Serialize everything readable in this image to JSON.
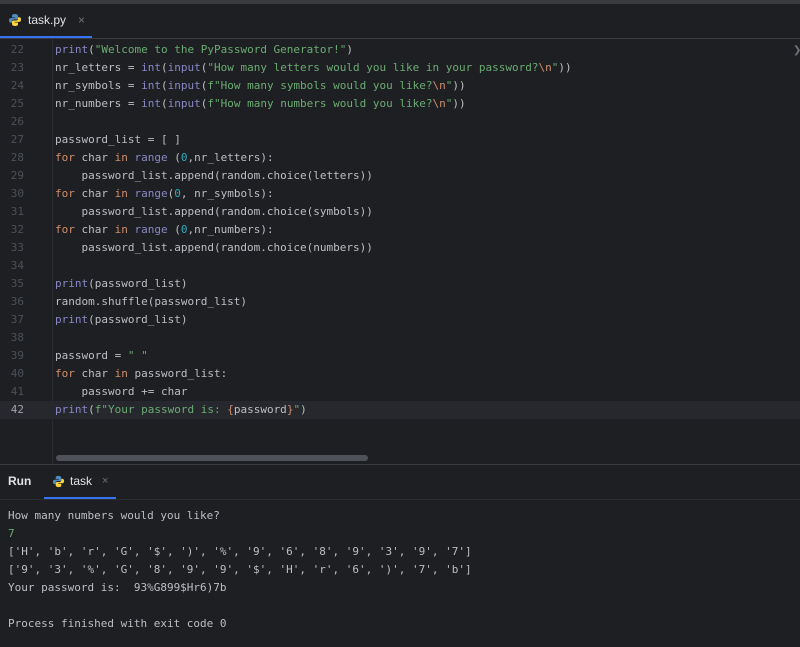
{
  "tab": {
    "filename": "task.py",
    "close": "×",
    "icon": "python-icon"
  },
  "editor": {
    "lines": [
      {
        "n": "22",
        "tokens": [
          [
            "bi",
            "print"
          ],
          [
            "p",
            "("
          ],
          [
            "st",
            "\"Welcome to the PyPassword Generator!\""
          ],
          [
            "p",
            ")"
          ]
        ]
      },
      {
        "n": "23",
        "tokens": [
          [
            "p",
            "nr_letters = "
          ],
          [
            "bi",
            "int"
          ],
          [
            "p",
            "("
          ],
          [
            "bi",
            "input"
          ],
          [
            "p",
            "("
          ],
          [
            "st",
            "\"How many letters would you like in your password?"
          ],
          [
            "esc",
            "\\n"
          ],
          [
            "st",
            "\""
          ],
          [
            "p",
            "))"
          ]
        ]
      },
      {
        "n": "24",
        "tokens": [
          [
            "p",
            "nr_symbols = "
          ],
          [
            "bi",
            "int"
          ],
          [
            "p",
            "("
          ],
          [
            "bi",
            "input"
          ],
          [
            "p",
            "("
          ],
          [
            "st",
            "f\"How many symbols would you like?"
          ],
          [
            "esc",
            "\\n"
          ],
          [
            "st",
            "\""
          ],
          [
            "p",
            "))"
          ]
        ]
      },
      {
        "n": "25",
        "tokens": [
          [
            "p",
            "nr_numbers = "
          ],
          [
            "bi",
            "int"
          ],
          [
            "p",
            "("
          ],
          [
            "bi",
            "input"
          ],
          [
            "p",
            "("
          ],
          [
            "st",
            "f\"How many numbers would you like?"
          ],
          [
            "esc",
            "\\n"
          ],
          [
            "st",
            "\""
          ],
          [
            "p",
            "))"
          ]
        ]
      },
      {
        "n": "26",
        "tokens": []
      },
      {
        "n": "27",
        "tokens": [
          [
            "p",
            "password_list = [ ]"
          ]
        ]
      },
      {
        "n": "28",
        "tokens": [
          [
            "kw",
            "for"
          ],
          [
            "p",
            " char "
          ],
          [
            "kw",
            "in"
          ],
          [
            "p",
            " "
          ],
          [
            "bi",
            "range"
          ],
          [
            "p",
            " ("
          ],
          [
            "num",
            "0"
          ],
          [
            "p",
            ",nr_letters):"
          ]
        ]
      },
      {
        "n": "29",
        "tokens": [
          [
            "p",
            "    password_list.append(random.choice(letters))"
          ]
        ]
      },
      {
        "n": "30",
        "tokens": [
          [
            "kw",
            "for"
          ],
          [
            "p",
            " char "
          ],
          [
            "kw",
            "in"
          ],
          [
            "p",
            " "
          ],
          [
            "bi",
            "range"
          ],
          [
            "p",
            "("
          ],
          [
            "num",
            "0"
          ],
          [
            "p",
            ", nr_symbols):"
          ]
        ]
      },
      {
        "n": "31",
        "tokens": [
          [
            "p",
            "    password_list.append(random.choice(symbols))"
          ]
        ]
      },
      {
        "n": "32",
        "tokens": [
          [
            "kw",
            "for"
          ],
          [
            "p",
            " char "
          ],
          [
            "kw",
            "in"
          ],
          [
            "p",
            " "
          ],
          [
            "bi",
            "range"
          ],
          [
            "p",
            " ("
          ],
          [
            "num",
            "0"
          ],
          [
            "p",
            ",nr_numbers):"
          ]
        ]
      },
      {
        "n": "33",
        "tokens": [
          [
            "p",
            "    password_list.append(random.choice(numbers))"
          ]
        ]
      },
      {
        "n": "34",
        "tokens": []
      },
      {
        "n": "35",
        "tokens": [
          [
            "bi",
            "print"
          ],
          [
            "p",
            "(password_list)"
          ]
        ]
      },
      {
        "n": "36",
        "tokens": [
          [
            "p",
            "random.shuffle(password_list)"
          ]
        ]
      },
      {
        "n": "37",
        "tokens": [
          [
            "bi",
            "print"
          ],
          [
            "p",
            "(password_list)"
          ]
        ]
      },
      {
        "n": "38",
        "tokens": []
      },
      {
        "n": "39",
        "tokens": [
          [
            "p",
            "password = "
          ],
          [
            "st",
            "\" \""
          ]
        ]
      },
      {
        "n": "40",
        "tokens": [
          [
            "kw",
            "for"
          ],
          [
            "p",
            " char "
          ],
          [
            "kw",
            "in"
          ],
          [
            "p",
            " password_list:"
          ]
        ]
      },
      {
        "n": "41",
        "tokens": [
          [
            "p",
            "    password += char"
          ]
        ]
      },
      {
        "n": "42",
        "tokens": [
          [
            "bi",
            "print"
          ],
          [
            "p",
            "("
          ],
          [
            "st",
            "f\"Your password is: "
          ],
          [
            "fmt",
            "{"
          ],
          [
            "p",
            "password"
          ],
          [
            "fmt",
            "}"
          ],
          [
            "st",
            "\""
          ],
          [
            "p",
            ")"
          ]
        ]
      }
    ],
    "current_line": "42"
  },
  "run_panel": {
    "label": "Run",
    "tab_name": "task",
    "tab_close": "×",
    "output": [
      {
        "text": "How many numbers would you like?",
        "kind": "text"
      },
      {
        "text": "7",
        "kind": "input"
      },
      {
        "text": "['H', 'b', 'r', 'G', '$', ')', '%', '9', '6', '8', '9', '3', '9', '7']",
        "kind": "text"
      },
      {
        "text": "['9', '3', '%', 'G', '8', '9', '9', '$', 'H', 'r', '6', ')', '7', 'b']",
        "kind": "text"
      },
      {
        "text": "Your password is:  93%G899$Hr6)7b",
        "kind": "text"
      },
      {
        "text": "",
        "kind": "text"
      },
      {
        "text": "Process finished with exit code 0",
        "kind": "text"
      }
    ]
  }
}
